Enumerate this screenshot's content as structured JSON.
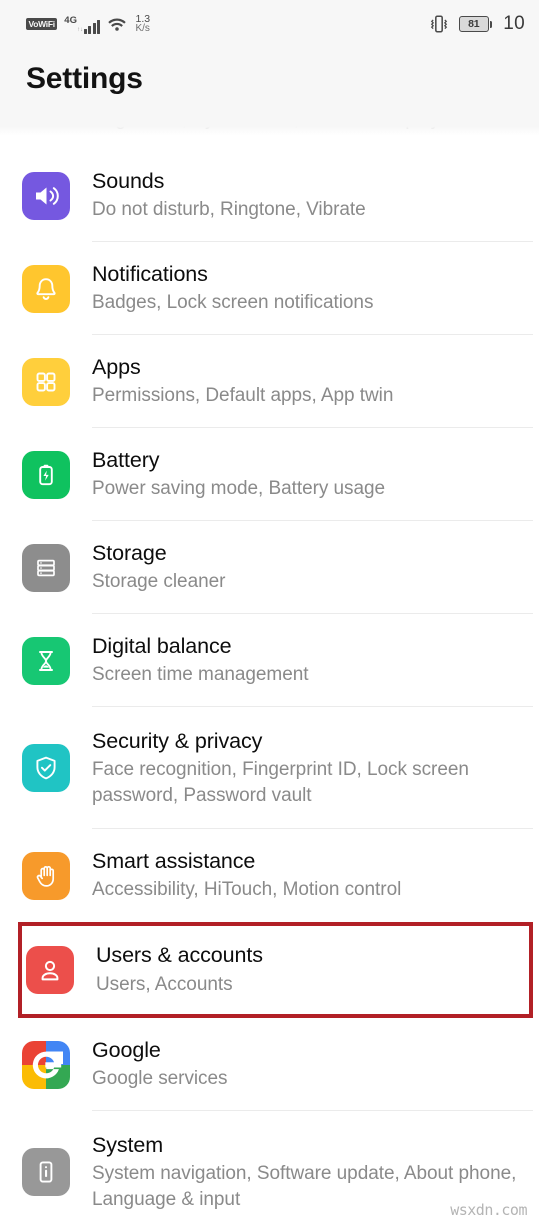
{
  "status_bar": {
    "vowifi_label": "VoWiFi",
    "network_type": "4G",
    "signal_arrows": "↑↓",
    "data_speed_value": "1.3",
    "data_speed_unit": "K/s",
    "vibrate_icon": "vibrate-icon",
    "battery_percent": "81",
    "time": "10"
  },
  "header": {
    "title": "Settings"
  },
  "scrolled_partial_row": {
    "subtitle": "Brightness, Eye comfort, Text and display size"
  },
  "annotation": {
    "highlight_color": "#b22026",
    "highlighted_item": "Users & accounts"
  },
  "watermark": {
    "text": "wsxdn.com"
  },
  "settings_list": {
    "items": [
      {
        "title": "Sounds",
        "subtitle": "Do not disturb, Ringtone, Vibrate",
        "icon_name": "volume-icon",
        "icon_color": "#7558e0"
      },
      {
        "title": "Notifications",
        "subtitle": "Badges, Lock screen notifications",
        "icon_name": "bell-icon",
        "icon_color": "#ffc62e"
      },
      {
        "title": "Apps",
        "subtitle": "Permissions, Default apps, App twin",
        "icon_name": "grid-apps-icon",
        "icon_color": "#ffcf3c"
      },
      {
        "title": "Battery",
        "subtitle": "Power saving mode, Battery usage",
        "icon_name": "battery-bolt-icon",
        "icon_color": "#0fc25f"
      },
      {
        "title": "Storage",
        "subtitle": "Storage cleaner",
        "icon_name": "storage-stack-icon",
        "icon_color": "#8d8d8d"
      },
      {
        "title": "Digital balance",
        "subtitle": "Screen time management",
        "icon_name": "hourglass-icon",
        "icon_color": "#17c773"
      },
      {
        "title": "Security & privacy",
        "subtitle": "Face recognition, Fingerprint ID, Lock screen password, Password vault",
        "icon_name": "shield-check-icon",
        "icon_color": "#20c4c4"
      },
      {
        "title": "Smart assistance",
        "subtitle": "Accessibility, HiTouch, Motion control",
        "icon_name": "hand-icon",
        "icon_color": "#f79a2b"
      },
      {
        "title": "Users & accounts",
        "subtitle": "Users, Accounts",
        "icon_name": "person-icon",
        "icon_color": "#ec4f4b"
      },
      {
        "title": "Google",
        "subtitle": "Google services",
        "icon_name": "google-logo-icon",
        "icon_color": "#ffffff"
      },
      {
        "title": "System",
        "subtitle": "System navigation, Software update, About phone, Language & input",
        "icon_name": "phone-info-icon",
        "icon_color": "#989898"
      }
    ]
  }
}
